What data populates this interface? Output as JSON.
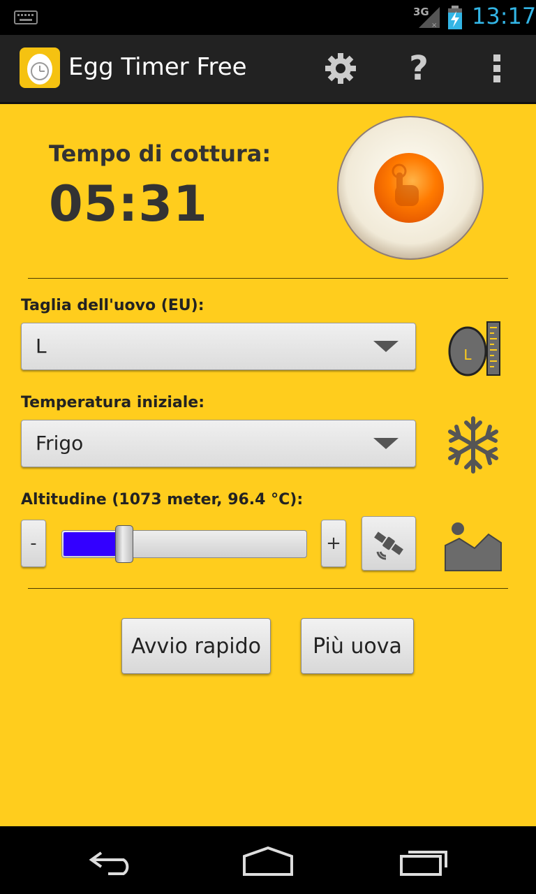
{
  "status_bar": {
    "network_type": "3G",
    "time": "13:17",
    "icons": [
      "keyboard-icon",
      "signal-icon",
      "battery-charging-icon"
    ]
  },
  "action_bar": {
    "title": "Egg Timer Free",
    "icons": [
      "app-egg-clock-icon",
      "gear-icon",
      "help-icon",
      "overflow-menu-icon"
    ],
    "help_glyph": "?"
  },
  "timer": {
    "label": "Tempo di cottura:",
    "value": "05:31"
  },
  "egg_size": {
    "label": "Taglia dell'uovo (EU):",
    "selected": "L",
    "icon": "egg-size-ruler-icon",
    "icon_letter": "L"
  },
  "start_temp": {
    "label": "Temperatura iniziale:",
    "selected": "Frigo",
    "icon": "snowflake-icon"
  },
  "altitude": {
    "label": "Altitudine (1073 meter, 96.4 °C):",
    "minus_label": "-",
    "plus_label": "+",
    "slider_fraction": 0.25,
    "fill_color": "#3300ff",
    "icons": [
      "satellite-gps-icon",
      "mountain-icon"
    ]
  },
  "buttons": {
    "quick_start": "Avvio rapido",
    "more_eggs": "Più uova"
  },
  "colors": {
    "background": "#ffcd1d",
    "clock": "#33b5e5"
  },
  "nav_bar": {
    "icons": [
      "back-icon",
      "home-icon",
      "recent-apps-icon"
    ]
  }
}
